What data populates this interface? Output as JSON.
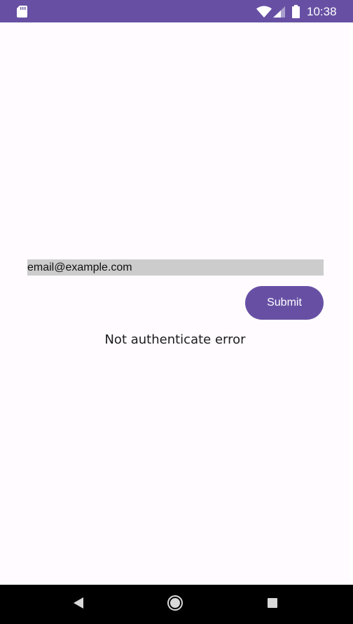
{
  "status_bar": {
    "time": "10:38",
    "background_color": "#6750A4",
    "icons": [
      "sd-card-icon",
      "wifi-icon",
      "cell-signal-icon",
      "battery-icon"
    ]
  },
  "form": {
    "email_value": "email@example.com",
    "submit_label": "Submit",
    "error_message": "Not authenticate error"
  },
  "navigation_bar": {
    "buttons": [
      "back-icon",
      "home-icon",
      "recents-icon"
    ]
  },
  "colors": {
    "accent": "#6750A4",
    "background": "#FFFBFE",
    "field_background": "#CCCCCC",
    "text": "#1C1B1F"
  }
}
